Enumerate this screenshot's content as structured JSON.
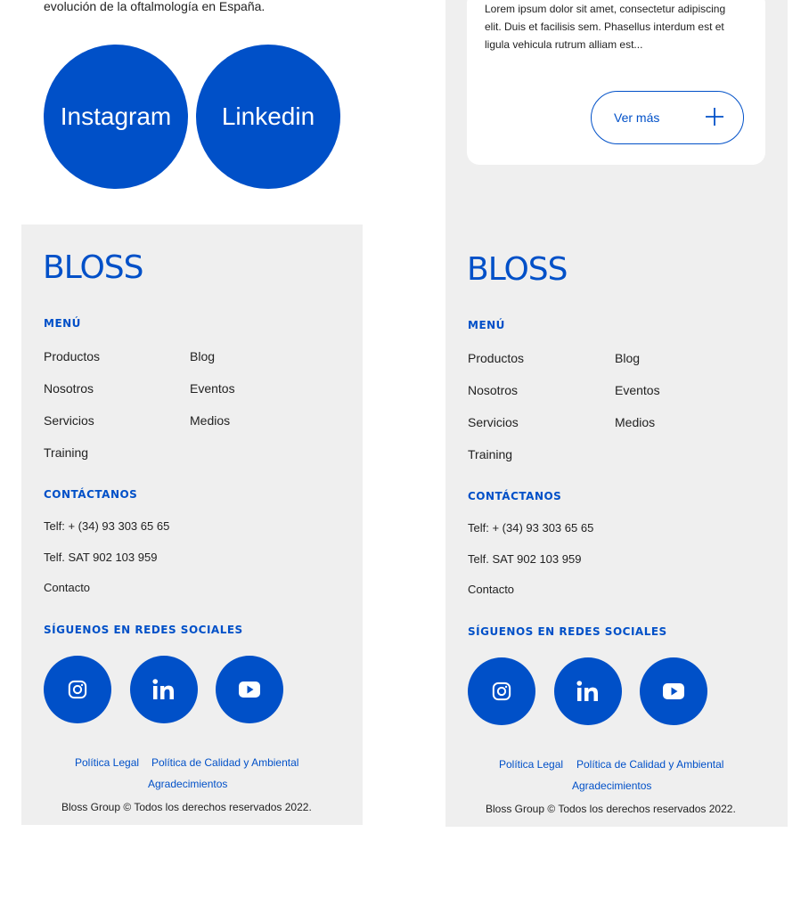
{
  "intro": {
    "text": "evolución de la oftalmología en España."
  },
  "social_circles": {
    "instagram": "Instagram",
    "linkedin": "Linkedin"
  },
  "card": {
    "text": "Lorem ipsum dolor sit amet, consectetur adipiscing elit. Duis et facilisis sem. Phasellus interdum est et ligula vehicula rutrum alliam est...",
    "ver_mas": "Ver más"
  },
  "footer": {
    "logo": "BLOSS",
    "menu_title": "MENÚ",
    "menu_col1": [
      "Productos",
      "Nosotros",
      "Servicios",
      "Training"
    ],
    "menu_col2": [
      "Blog",
      "Eventos",
      "Medios"
    ],
    "contact_title": "CONTÁCTANOS",
    "contact": [
      "Telf: + (34) 93 303 65 65",
      "Telf. SAT 902 103 959",
      "Contacto"
    ],
    "social_title": "SÍGUENOS EN REDES SOCIALES",
    "social_icons": [
      "instagram-icon",
      "linkedin-icon",
      "youtube-icon"
    ],
    "legal": [
      "Política Legal",
      "Política de Calidad y Ambiental",
      "Agradecimientos"
    ],
    "copyright": "Bloss Group © Todos los derechos reservados 2022."
  },
  "colors": {
    "brand_blue": "#0050c8",
    "footer_bg": "#efefef"
  }
}
